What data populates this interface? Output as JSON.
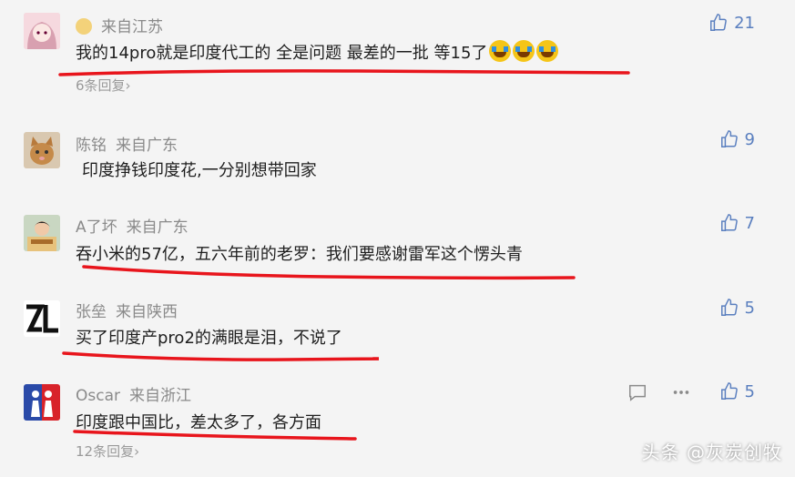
{
  "comments": [
    {
      "author": "",
      "location": "来自江苏",
      "text": "我的14pro就是印度代工的 全是问题 最差的一批 等15了",
      "emoji": [
        "crying-face",
        "crying-face",
        "crying-face"
      ],
      "likes": "21",
      "replies": "6条回复",
      "avatar": "anime-girl"
    },
    {
      "author": "陈铭",
      "location": "来自广东",
      "text": "印度挣钱印度花,一分别想带回家",
      "likes": "9",
      "avatar": "cat"
    },
    {
      "author": "A了坏",
      "location": "来自广东",
      "text": "吞小米的57亿，五六年前的老罗：我们要感谢雷军这个愣头青",
      "likes": "7",
      "avatar": "person-with-money"
    },
    {
      "author": "张垒",
      "location": "来自陕西",
      "text": "买了印度产pro2的满眼是泪，不说了",
      "likes": "5",
      "avatar": "zl-logo"
    },
    {
      "author": "Oscar",
      "location": "来自浙江",
      "text": "印度跟中国比，差太多了，各方面",
      "likes": "5",
      "replies": "12条回复",
      "avatar": "figures"
    }
  ],
  "watermark": "头条 @灰炭创牧",
  "colors": {
    "underline": "#e8151c",
    "like": "#5a7fbf",
    "meta": "#8a8a8a"
  }
}
